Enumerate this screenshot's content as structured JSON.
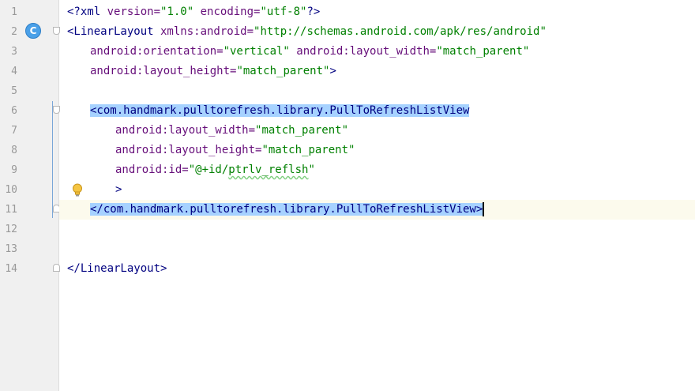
{
  "editor": {
    "line_numbers": [
      "1",
      "2",
      "3",
      "4",
      "5",
      "6",
      "7",
      "8",
      "9",
      "10",
      "11",
      "12",
      "13",
      "14"
    ],
    "badge_label": "C",
    "lines": {
      "l1": {
        "decl_open": "<?xml",
        "attr1": " version=",
        "val1": "\"1.0\"",
        "attr2": " encoding=",
        "val2": "\"utf-8\"",
        "decl_close": "?>"
      },
      "l2": {
        "tag_open": "<LinearLayout",
        "attr1": " xmlns:android=",
        "val1": "\"http://schemas.android.com/apk/res/android\""
      },
      "l3": {
        "attr1": "android:orientation=",
        "val1": "\"vertical\"",
        "attr2": " android:layout_width=",
        "val2": "\"match_parent\""
      },
      "l4": {
        "attr1": "android:layout_height=",
        "val1": "\"match_parent\"",
        "tag_close": ">"
      },
      "l6": {
        "tag_open": "<com.handmark.pulltorefresh.library.PullToRefreshListView"
      },
      "l7": {
        "attr1": "android:layout_width=",
        "val1": "\"match_parent\""
      },
      "l8": {
        "attr1": "android:layout_height=",
        "val1": "\"match_parent\""
      },
      "l9": {
        "attr1": "android:id=",
        "val1": "\"@+id/",
        "val1b": "ptrlv_reflsh",
        "val1c": "\""
      },
      "l10": {
        "tag_close": ">"
      },
      "l11": {
        "tag_close": "</com.handmark.pulltorefresh.library.PullToRefreshListView>"
      },
      "l14": {
        "tag_close": "</LinearLayout>"
      }
    }
  },
  "colors": {
    "tag": "#000080",
    "attribute": "#660e7a",
    "value": "#008000",
    "selection": "#a6d2ff",
    "current_line": "#fcfaed"
  },
  "icons": {
    "class_badge": "class-badge-icon",
    "bulb": "lightbulb-icon",
    "fold": "fold-marker-icon"
  }
}
